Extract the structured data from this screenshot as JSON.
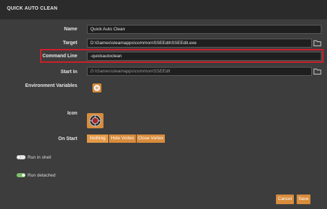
{
  "window": {
    "title": "QUICK AUTO CLEAN"
  },
  "form": {
    "name": {
      "label": "Name",
      "value": "Quick Auto Clean"
    },
    "target": {
      "label": "Target",
      "value": "D:\\Games\\steamapps\\common\\SSEEdit\\SSEEdit.exe"
    },
    "command_line": {
      "label": "Command Line",
      "value": "-quickautoclean"
    },
    "start_in": {
      "label": "Start In",
      "value": "D:\\Games\\steamapps\\common\\SSEEdit"
    },
    "environment_variables": {
      "label": "Environment Variables"
    },
    "icon": {
      "label": "Icon"
    },
    "on_start": {
      "label": "On Start",
      "options": [
        "Nothing",
        "Hide Vortex",
        "Close Vortex"
      ],
      "selected": "Nothing"
    }
  },
  "toggles": [
    {
      "label": "Run in shell",
      "on": false
    },
    {
      "label": "Run detached",
      "on": true
    }
  ],
  "footer": {
    "cancel_label": "Cancel",
    "save_label": "Save"
  },
  "colors": {
    "accent": "#d88c3c",
    "highlight": "#d21f2b",
    "toggle_on": "#7cbf6b"
  },
  "icons": {
    "folder": "folder-icon",
    "add": "plus-circle-icon",
    "app": "sseedit-icon"
  }
}
